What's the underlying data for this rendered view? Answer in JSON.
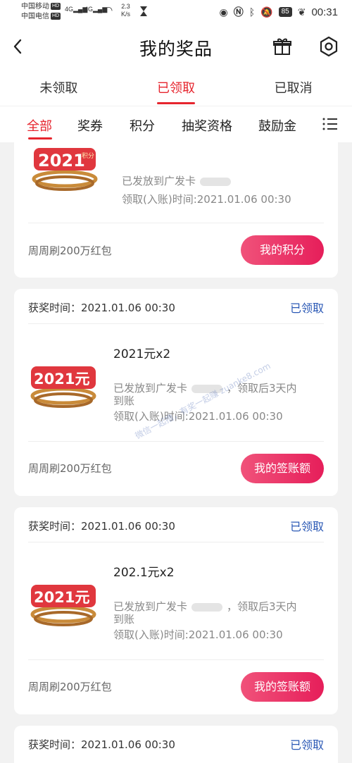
{
  "status_bar": {
    "carrier1": "中国移动",
    "carrier2": "中国电信",
    "hd": "HD",
    "net1": "4G",
    "net2": "4G",
    "speed_value": "2.3",
    "speed_unit": "K/s",
    "battery": "85",
    "time": "00:31"
  },
  "header": {
    "title": "我的奖品"
  },
  "tabs": [
    {
      "label": "未领取",
      "active": false
    },
    {
      "label": "已领取",
      "active": true
    },
    {
      "label": "已取消",
      "active": false
    }
  ],
  "categories": [
    {
      "label": "全部",
      "active": true
    },
    {
      "label": "奖券",
      "active": false
    },
    {
      "label": "积分",
      "active": false
    },
    {
      "label": "抽奖资格",
      "active": false
    },
    {
      "label": "鼓励金",
      "active": false
    }
  ],
  "cards": [
    {
      "badge_year": "2021",
      "badge_suffix": "积分",
      "issued": "已发放到广发卡",
      "time_line": "领取(入账)时间:2021.01.06 00:30",
      "campaign": "周周刷200万红包",
      "button": "我的积分"
    },
    {
      "date": "获奖时间：2021.01.06 00:30",
      "status": "已领取",
      "badge_year": "2021元",
      "name": "2021元x2",
      "issued_a": "已发放到广发卡",
      "issued_b": "，领取后3天内",
      "issued_c": "到账",
      "time_line": "领取(入账)时间:2021.01.06 00:30",
      "campaign": "周周刷200万红包",
      "button": "我的签账额"
    },
    {
      "date": "获奖时间：2021.01.06 00:30",
      "status": "已领取",
      "badge_year": "2021元",
      "name": "202.1元x2",
      "issued_a": "已发放到广发卡",
      "issued_b": "，领取后3天内",
      "issued_c": "到账",
      "time_line": "领取(入账)时间:2021.01.06 00:30",
      "campaign": "周周刷200万红包",
      "button": "我的签账额"
    },
    {
      "date": "获奖时间：2021.01.06 00:30",
      "status": "已领取"
    }
  ],
  "watermark": "微信一起撸，有奖一起赚 zuanke8.com",
  "colors": {
    "accent": "#e6252e",
    "status_blue": "#2a58b5",
    "button_pink": "#e61e5a"
  }
}
